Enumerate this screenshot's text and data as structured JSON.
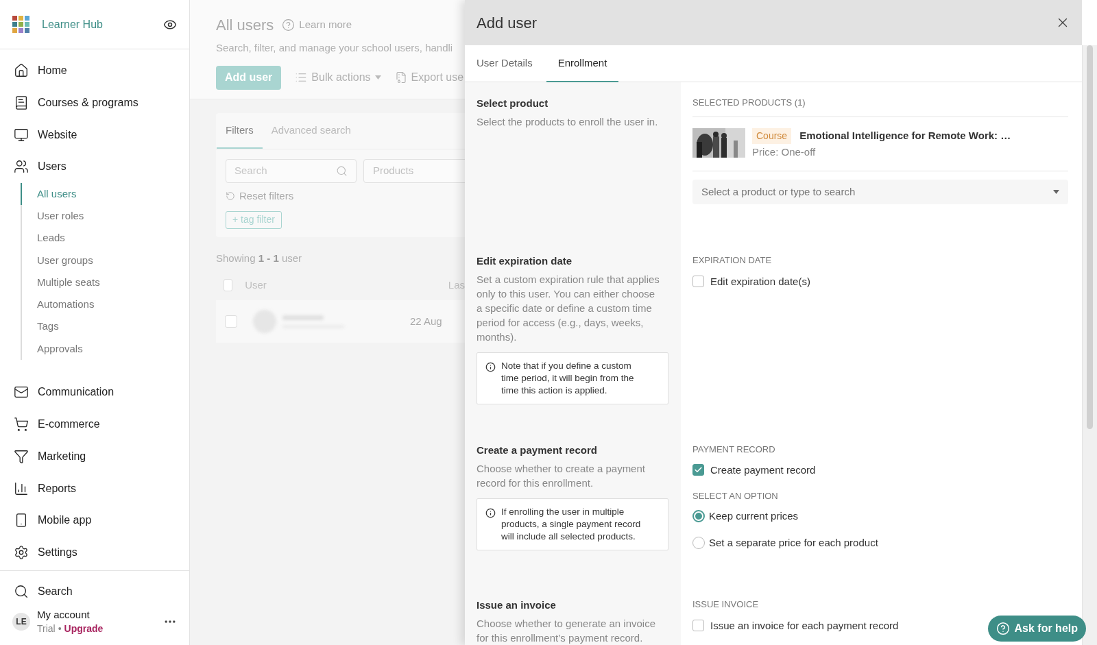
{
  "sidebar": {
    "brand": "Learner Hub",
    "nav": [
      {
        "label": "Home",
        "selected": false
      },
      {
        "label": "Courses & programs",
        "selected": false
      },
      {
        "label": "Website",
        "selected": false
      },
      {
        "label": "Users",
        "selected": false,
        "children": [
          {
            "label": "All users",
            "selected": true
          },
          {
            "label": "User roles",
            "selected": false
          },
          {
            "label": "Leads",
            "selected": false
          },
          {
            "label": "User groups",
            "selected": false
          },
          {
            "label": "Multiple seats",
            "selected": false
          },
          {
            "label": "Automations",
            "selected": false
          },
          {
            "label": "Tags",
            "selected": false
          },
          {
            "label": "Approvals",
            "selected": false
          }
        ]
      },
      {
        "label": "Communication",
        "selected": false
      },
      {
        "label": "E-commerce",
        "selected": false
      },
      {
        "label": "Marketing",
        "selected": false
      },
      {
        "label": "Reports",
        "selected": false
      },
      {
        "label": "Mobile app",
        "selected": false
      },
      {
        "label": "Settings",
        "selected": false
      }
    ],
    "search": "Search",
    "account": {
      "initials": "LE",
      "name": "My account",
      "plan": "Trial",
      "separator": "•",
      "upgrade": "Upgrade"
    }
  },
  "page": {
    "title": "All users",
    "learn_more": "Learn more",
    "subtitle": "Search, filter, and manage your school users, handli",
    "actions": {
      "add": "Add user",
      "bulk": "Bulk actions",
      "export": "Export use"
    },
    "filter_tabs": [
      {
        "label": "Filters",
        "selected": true
      },
      {
        "label": "Advanced search",
        "selected": false
      }
    ],
    "search_placeholder": "Search",
    "products_placeholder": "Products",
    "reset": "Reset filters",
    "tag_filter": "+ tag filter",
    "showing": "Showing **1 - 1** user",
    "select_all_checked": false,
    "columns": [
      "User",
      "Las"
    ],
    "rows": [
      {
        "checked": false,
        "date": "22 Aug"
      }
    ]
  },
  "drawer": {
    "title": "Add user",
    "tabs": [
      {
        "label": "User Details",
        "selected": false
      },
      {
        "label": "Enrollment",
        "selected": true
      }
    ],
    "sections": [
      {
        "kind": "products",
        "title": "Select product",
        "description": "Select the products to enroll the user in.",
        "heading": "SELECTED PRODUCTS (1)",
        "products": [
          {
            "type": "Course",
            "name": "Emotional Intelligence for Remote Work: …",
            "price": "Price: One-off"
          }
        ],
        "select_placeholder": "Select a product or type to search"
      },
      {
        "kind": "expiration",
        "title": "Edit expiration date",
        "description": "Set a custom expiration rule that applies only to this user. You can either choose a specific date or define a custom time period for access (e.g., days, weeks, months).",
        "note": "Note that if you define a custom time period, it will begin from the time this action is applied.",
        "heading": "EXPIRATION DATE",
        "checkbox": {
          "label": "Edit expiration date(s)",
          "checked": false
        }
      },
      {
        "kind": "payment",
        "title": "Create a payment record",
        "description": "Choose whether to create a payment record for this enrollment.",
        "note": "If enrolling the user in multiple products, a single payment record will include all selected products.",
        "heading": "PAYMENT RECORD",
        "checkbox": {
          "label": "Create payment record",
          "checked": true
        },
        "option_heading": "SELECT AN OPTION",
        "options": [
          {
            "label": "Keep current prices",
            "selected": true
          },
          {
            "label": "Set a separate price for each product",
            "selected": false
          }
        ]
      },
      {
        "kind": "invoice",
        "title": "Issue an invoice",
        "description": "Choose whether to generate an invoice for this enrollment’s payment record.",
        "heading": "ISSUE INVOICE",
        "checkbox": {
          "label": "Issue an invoice for each payment record",
          "checked": false
        }
      }
    ]
  },
  "help_button": "Ask for help"
}
